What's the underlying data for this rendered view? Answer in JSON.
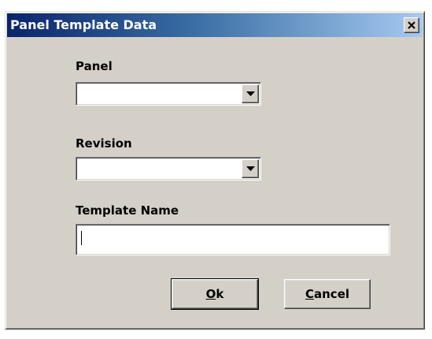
{
  "window": {
    "title": "Panel Template Data"
  },
  "panel": {
    "label": "Panel",
    "value": ""
  },
  "revision": {
    "label": "Revision",
    "value": ""
  },
  "template_name": {
    "label": "Template Name",
    "value": ""
  },
  "buttons": {
    "ok": {
      "mnemonic": "O",
      "rest": "k"
    },
    "cancel": {
      "mnemonic": "C",
      "rest": "ancel"
    }
  },
  "icons": {
    "close": "close-icon",
    "dropdown": "chevron-down-icon"
  },
  "colors": {
    "face": "#d4d0c8",
    "title_start": "#0a246a",
    "title_end": "#a6caf0"
  }
}
